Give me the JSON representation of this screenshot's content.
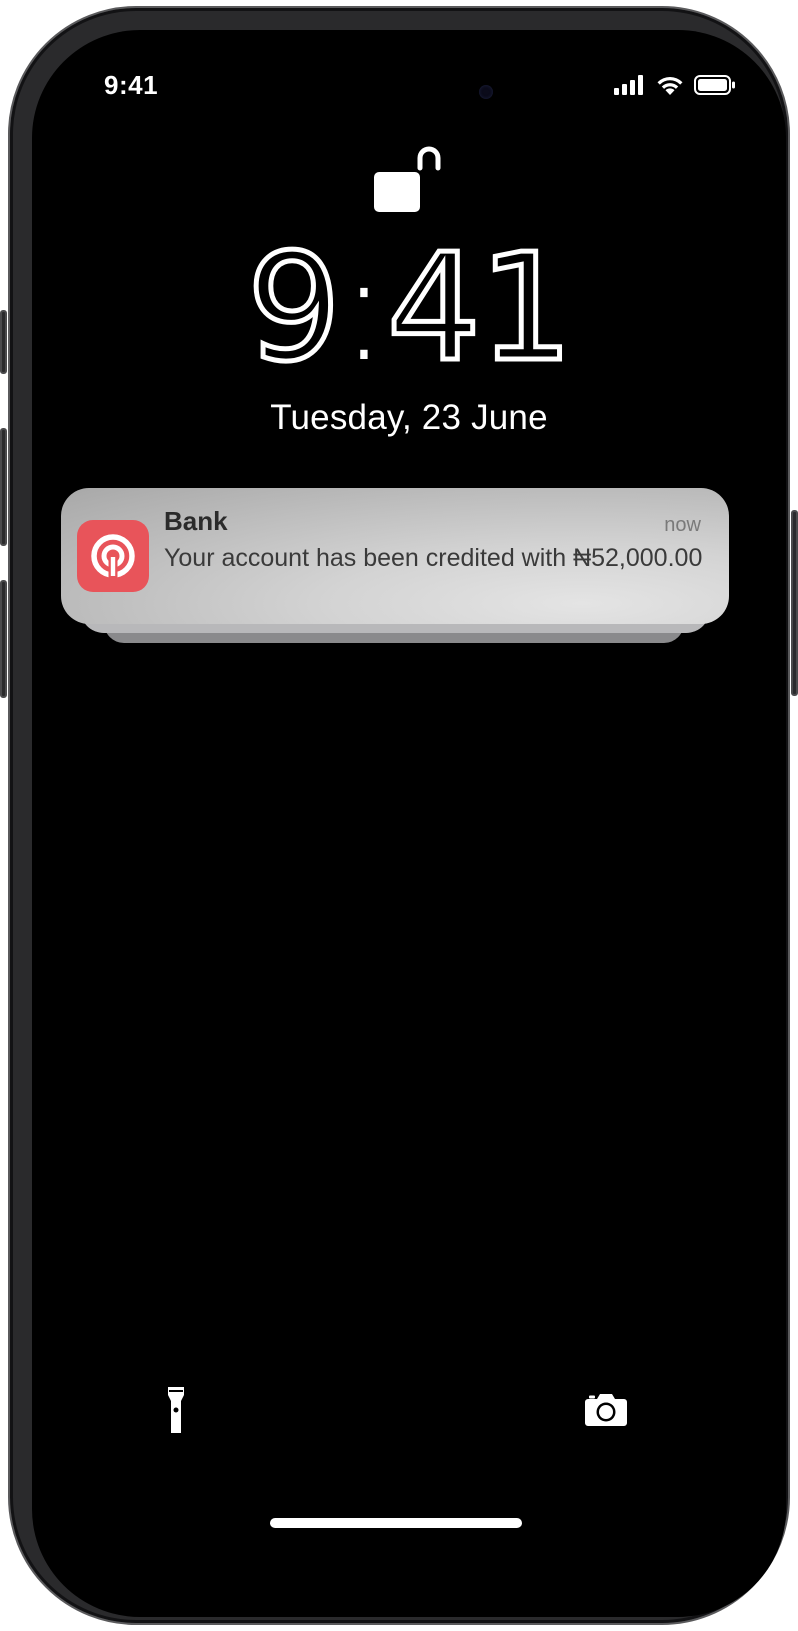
{
  "status_bar": {
    "time": "9:41",
    "icons": [
      "cellular-signal-icon",
      "wifi-icon",
      "battery-icon"
    ]
  },
  "lock_screen": {
    "lock_icon": "unlocked-padlock-icon",
    "time_hour": "9",
    "time_minutes": "41",
    "date": "Tuesday, 23 June"
  },
  "notification": {
    "app_name": "Bank",
    "timestamp": "now",
    "message": "Your account has been credited with ₦52,000.00",
    "app_icon": "bank-logo-icon",
    "icon_color": "#e8545a"
  },
  "quick_actions": {
    "left": "flashlight-icon",
    "right": "camera-icon"
  }
}
